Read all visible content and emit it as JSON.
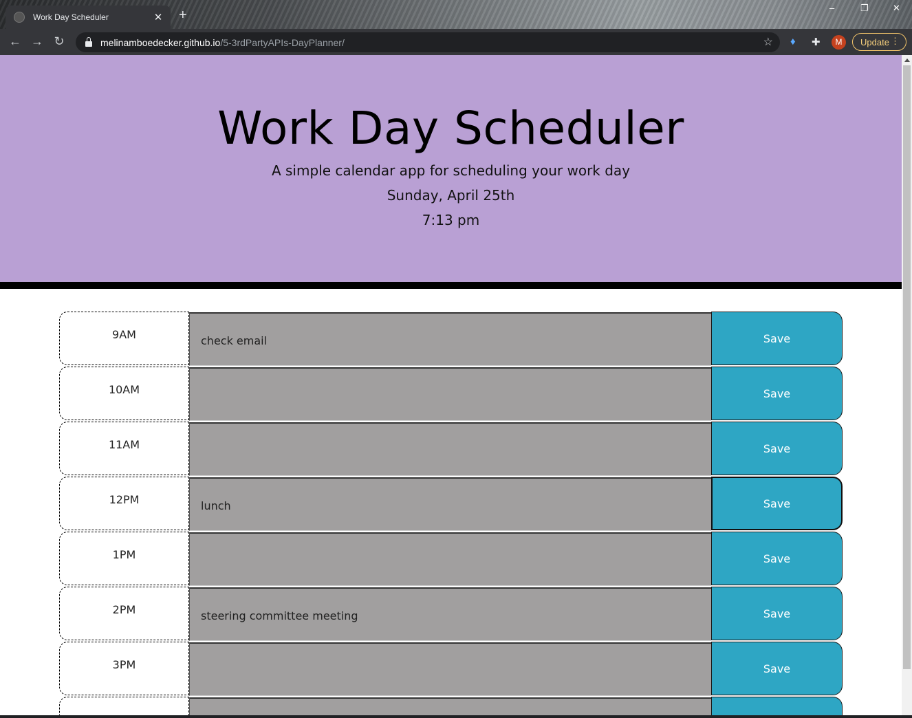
{
  "browser": {
    "tab_title": "Work Day Scheduler",
    "tab_close": "✕",
    "new_tab": "+",
    "url_host": "melinamboedecker.github.io",
    "url_path": "/5-3rdPartyAPIs-DayPlanner/",
    "avatar_letter": "M",
    "update_label": "Update",
    "window_controls": [
      "–",
      "❐",
      "✕"
    ]
  },
  "header": {
    "title": "Work Day Scheduler",
    "subtitle": "A simple calendar app for scheduling your work day",
    "date": "Sunday, April 25th",
    "time": "7:13 pm"
  },
  "colors": {
    "header_bg": "#b9a0d4",
    "past_block": "#a19f9f",
    "save_button": "#2ea6c4"
  },
  "schedule": {
    "save_label": "Save",
    "rows": [
      {
        "hour": "9AM",
        "text": "check email"
      },
      {
        "hour": "10AM",
        "text": ""
      },
      {
        "hour": "11AM",
        "text": ""
      },
      {
        "hour": "12PM",
        "text": "lunch"
      },
      {
        "hour": "1PM",
        "text": ""
      },
      {
        "hour": "2PM",
        "text": "steering committee meeting"
      },
      {
        "hour": "3PM",
        "text": ""
      },
      {
        "hour": "",
        "text": ""
      }
    ]
  }
}
